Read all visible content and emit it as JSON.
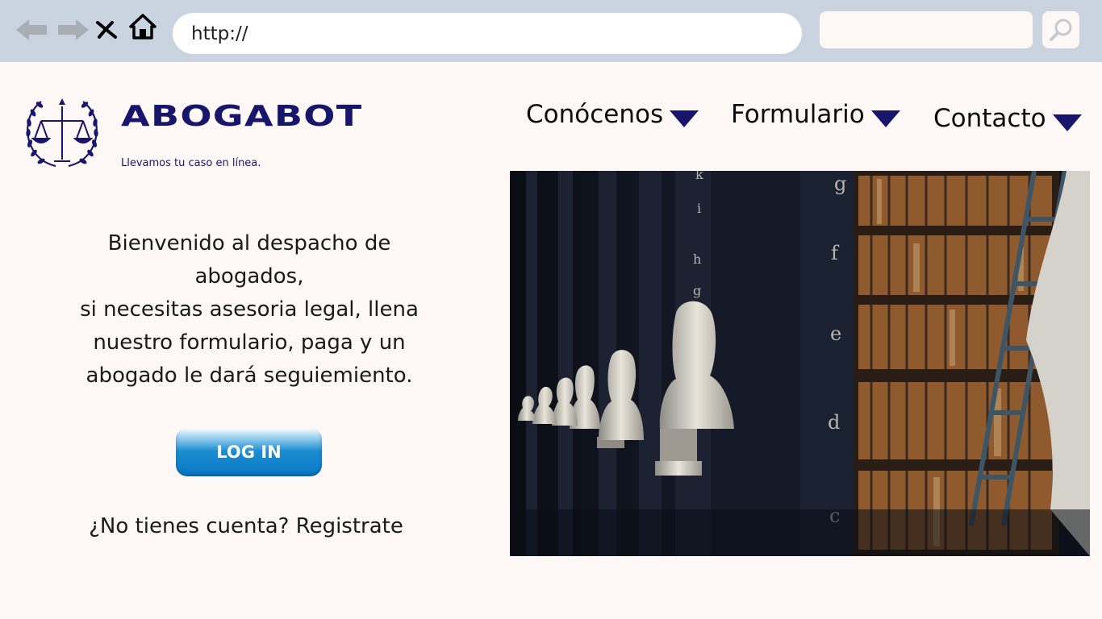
{
  "browser": {
    "url": "http://",
    "icons": [
      "back-arrow-icon",
      "forward-arrow-icon",
      "close-icon",
      "home-icon",
      "search-icon"
    ]
  },
  "brand": {
    "name": "ABOGABOT",
    "tagline": "Llevamos tu caso en línea.",
    "logo_icon": "scales-of-justice-laurel-icon"
  },
  "menu": [
    {
      "label": "Conócenos"
    },
    {
      "label": "Formulario"
    },
    {
      "label": "Contacto"
    }
  ],
  "welcome": {
    "lines": [
      "Bienvenido al despacho de",
      "abogados,",
      "si necesitas asesoria legal, llena",
      "nuestro formulario, paga y un",
      "abogado le dará seguiemiento."
    ]
  },
  "login": {
    "label": "LOG IN"
  },
  "register": {
    "label": "¿No tienes cuenta? Registrate"
  },
  "photo": {
    "description_icon": "library-busts-photo",
    "shelf_letters": [
      "g",
      "f",
      "e",
      "d",
      "c",
      "k",
      "i",
      "h",
      "g"
    ]
  },
  "colors": {
    "brand": "#17166b",
    "chrome": "#c9d4e0",
    "background": "#fdf8f6",
    "button": "#1b8cd0"
  }
}
